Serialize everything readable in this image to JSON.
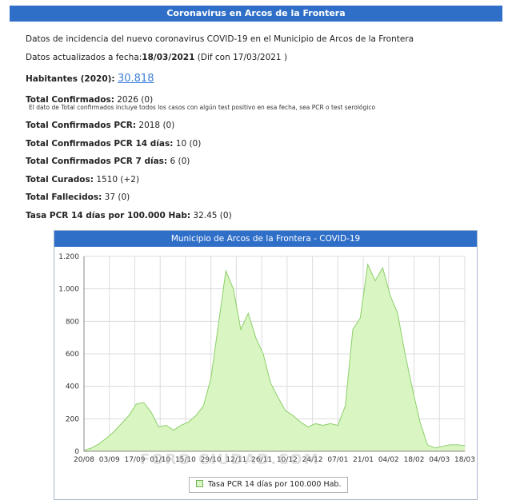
{
  "header": {
    "title": "Coronavirus en Arcos de la Frontera"
  },
  "intro": "Datos de incidencia del nuevo coronavirus COVID-19 en el Municipio de Arcos de la Frontera",
  "update": {
    "prefix": "Datos actualizados a fecha:",
    "date": "18/03/2021",
    "suffix": "(Dif con 17/03/2021 )"
  },
  "habitantes": {
    "label": "Habitantes (2020):",
    "value": "30.818"
  },
  "stats": {
    "total_confirmados": {
      "label": "Total Confirmados:",
      "value": "2026 (0)"
    },
    "note": "El dato de Total confirmados incluye todos los casos con algún test positivo en esa fecha, sea PCR o test serológico",
    "confirmados_pcr": {
      "label": "Total Confirmados PCR:",
      "value": "2018 (0)"
    },
    "pcr_14": {
      "label": "Total Confirmados PCR 14 días:",
      "value": "10 (0)"
    },
    "pcr_7": {
      "label": "Total Confirmados PCR 7 días:",
      "value": "6 (0)"
    },
    "curados": {
      "label": "Total Curados:",
      "value": "1510 (+2)"
    },
    "fallecidos": {
      "label": "Total Fallecidos:",
      "value": "37 (0)"
    },
    "tasa": {
      "label": "Tasa PCR 14 días por 100.000 Hab:",
      "value": "32.45 (0)"
    }
  },
  "chart_data": {
    "type": "area",
    "title": "Municipio de Arcos de la Frontera - COVID-19",
    "ylim": [
      0,
      1200
    ],
    "yticks": [
      "0",
      "200",
      "400",
      "600",
      "800",
      "1.000",
      "1.200"
    ],
    "ytick_values": [
      0,
      200,
      400,
      600,
      800,
      1000,
      1200
    ],
    "xticks": [
      "20/08",
      "03/09",
      "17/09",
      "01/10",
      "15/10",
      "29/10",
      "12/11",
      "26/11",
      "10/12",
      "24/12",
      "07/01",
      "21/01",
      "04/02",
      "18/02",
      "04/03",
      "18/03"
    ],
    "grid": true,
    "series": [
      {
        "name": "Tasa PCR 14 días por 100.000 Hab.",
        "color": "#d9f5c1",
        "line_color": "#8ccf6a",
        "values": [
          5,
          20,
          45,
          80,
          120,
          170,
          220,
          290,
          300,
          240,
          150,
          160,
          130,
          160,
          180,
          220,
          280,
          450,
          780,
          1110,
          1000,
          750,
          850,
          700,
          600,
          420,
          330,
          250,
          220,
          180,
          150,
          170,
          160,
          170,
          160,
          280,
          750,
          820,
          1150,
          1050,
          1130,
          960,
          850,
          600,
          380,
          180,
          40,
          20,
          30,
          40,
          40,
          35
        ]
      }
    ],
    "legend": "bottom"
  },
  "watermark": "FORO CIUDAD.COM"
}
